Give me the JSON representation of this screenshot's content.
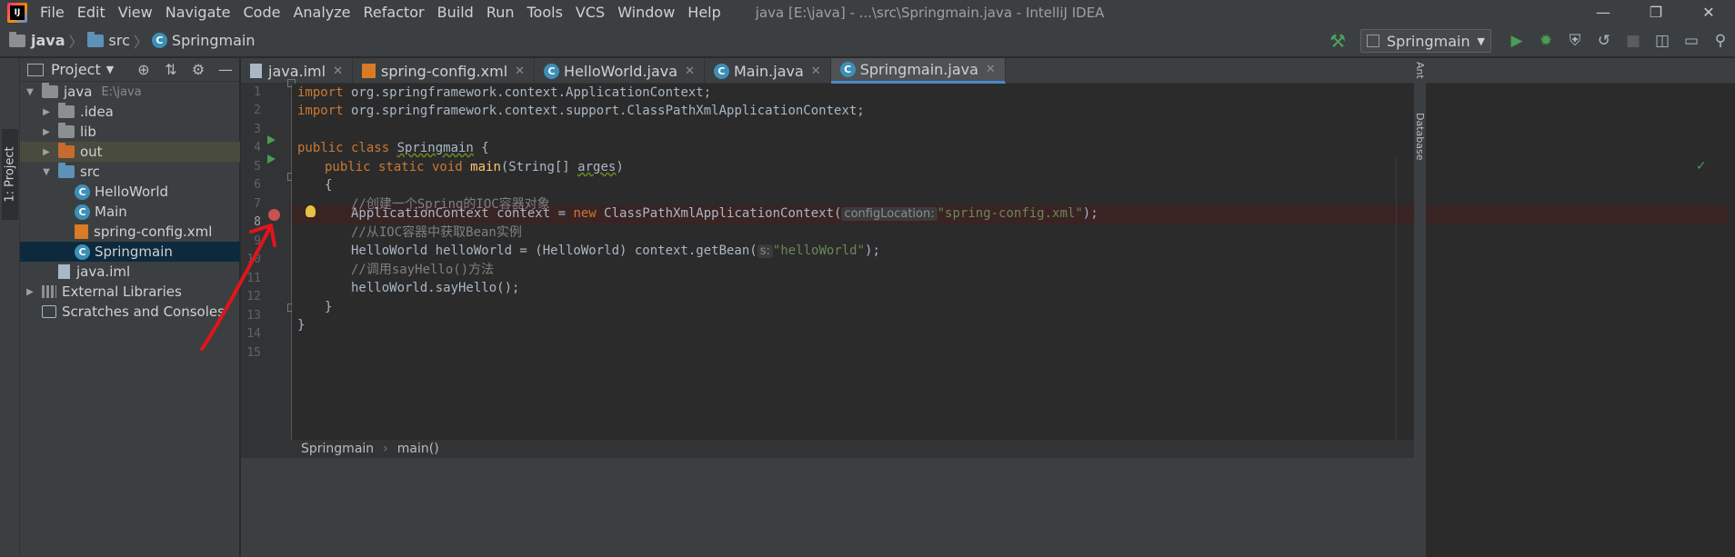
{
  "menu": {
    "items": [
      "File",
      "Edit",
      "View",
      "Navigate",
      "Code",
      "Analyze",
      "Refactor",
      "Build",
      "Run",
      "Tools",
      "VCS",
      "Window",
      "Help"
    ],
    "window_title": "java [E:\\java] - ...\\src\\Springmain.java - IntelliJ IDEA"
  },
  "nav": {
    "crumbs": [
      "java",
      "src",
      "Springmain"
    ],
    "run_config": "Springmain"
  },
  "left_stripe": {
    "project_tab": "1: Project"
  },
  "project_panel": {
    "title": "Project",
    "tree": [
      {
        "label": "java",
        "detail": "E:\\java"
      },
      {
        "label": ".idea"
      },
      {
        "label": "lib"
      },
      {
        "label": "out"
      },
      {
        "label": "src"
      },
      {
        "label": "HelloWorld"
      },
      {
        "label": "Main"
      },
      {
        "label": "spring-config.xml"
      },
      {
        "label": "Springmain"
      },
      {
        "label": "java.iml"
      },
      {
        "label": "External Libraries"
      },
      {
        "label": "Scratches and Consoles"
      }
    ]
  },
  "tabs": [
    "java.iml",
    "spring-config.xml",
    "HelloWorld.java",
    "Main.java",
    "Springmain.java"
  ],
  "line_numbers": [
    "1",
    "2",
    "3",
    "4",
    "5",
    "6",
    "7",
    "8",
    "9",
    "10",
    "11",
    "12",
    "13",
    "14",
    "15"
  ],
  "code": {
    "l1_kw": "import",
    "l1_rest": " org.springframework.context.ApplicationContext;",
    "l2_kw": "import",
    "l2_rest": " org.springframework.context.support.ClassPathXmlApplicationContext;",
    "l4_kw": "public class ",
    "l4_name": "Springmain",
    "l4_rest": " {",
    "l5_kw": "public static void ",
    "l5_fn": "main",
    "l5_a": "(String[] ",
    "l5_param": "arges",
    "l5_b": ")",
    "l6": "{",
    "l7": "//创建一个Spring的IOC容器对象",
    "l8_a": "ApplicationContext context = ",
    "l8_kw": "new",
    "l8_b": " ClassPathXmlApplicationContext(",
    "l8_hint": "configLocation:",
    "l8_str": "\"spring-config.xml\"",
    "l8_c": ");",
    "l9": "//从IOC容器中获取Bean实例",
    "l10_a": "HelloWorld helloWorld = (HelloWorld) context.getBean(",
    "l10_hint": "s:",
    "l10_str": "\"helloWorld\"",
    "l10_c": ");",
    "l11": "//调用sayHello()方法",
    "l12": "helloWorld.sayHello();",
    "l13": "}",
    "l14": "}"
  },
  "right_stripe": {
    "ant": "Ant",
    "database": "Database"
  },
  "breadcrumbs": [
    "Springmain",
    "main()"
  ],
  "colors": {
    "annotation_arrow": "#e0151b",
    "breakpoint": "#c75450",
    "run_marker": "#499c54"
  }
}
